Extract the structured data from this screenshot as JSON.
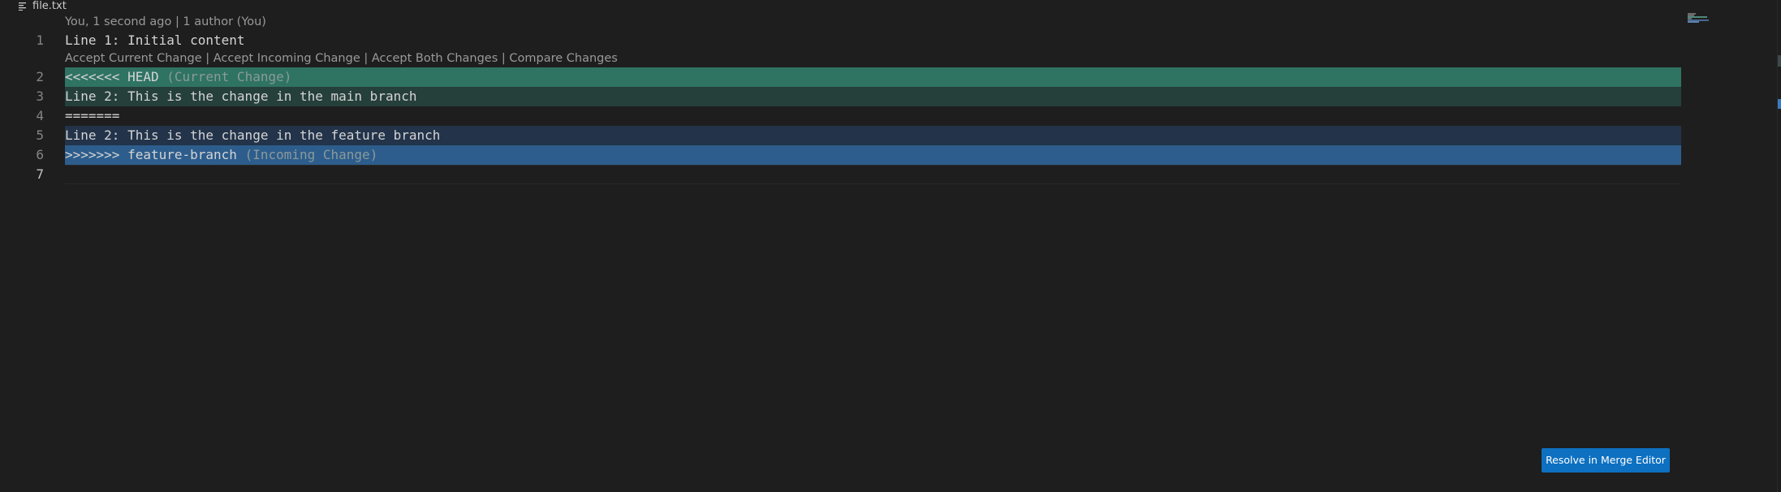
{
  "breadcrumb": {
    "file_icon": "file-lines-icon",
    "file_name": "file.txt"
  },
  "blame": "You, 1 second ago | 1 author (You)",
  "merge_actions": {
    "accept_current": "Accept Current Change",
    "accept_incoming": "Accept Incoming Change",
    "accept_both": "Accept Both Changes",
    "compare": "Compare Changes",
    "separator": "|"
  },
  "lines": [
    {
      "number": "1",
      "text": "Line 1: Initial content"
    },
    {
      "number": "2",
      "text": "<<<<<<< HEAD",
      "annotation": "(Current Change)"
    },
    {
      "number": "3",
      "text": "Line 2: This is the change in the main branch"
    },
    {
      "number": "4",
      "text": "======="
    },
    {
      "number": "5",
      "text": "Line 2: This is the change in the feature branch"
    },
    {
      "number": "6",
      "text": ">>>>>>> feature-branch",
      "annotation": "(Incoming Change)"
    },
    {
      "number": "7",
      "text": ""
    }
  ],
  "resolve_button": "Resolve in Merge Editor",
  "colors": {
    "editor_background": "#1e1e1e",
    "current_header": "#2f7363",
    "current_body": "#253f3a",
    "incoming_body": "#22334a",
    "incoming_header": "#2d5d8c",
    "button": "#0e70c0"
  }
}
